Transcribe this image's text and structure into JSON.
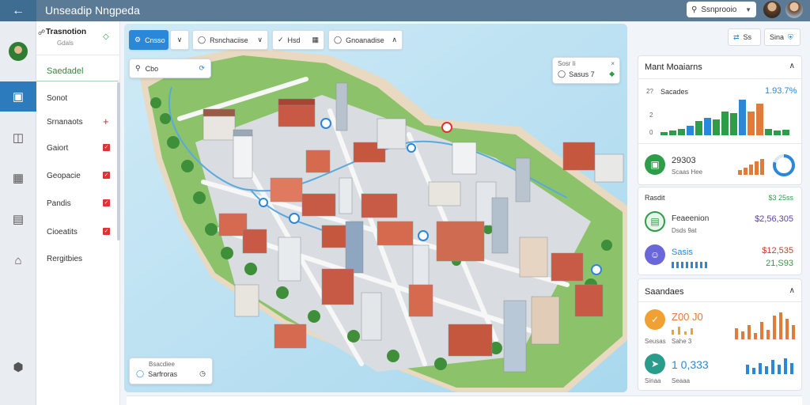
{
  "app": {
    "title": "Unseadip Nngpeda"
  },
  "topbar": {
    "search_label": "Ssnprooio"
  },
  "sidebar": {
    "header_title": "Trasnotion",
    "header_sub": "Gdals",
    "section": "Saedadel",
    "items": [
      {
        "label": "Sonot"
      },
      {
        "label": "Srnanaots"
      },
      {
        "label": "Gaiort"
      },
      {
        "label": "Geopacie"
      },
      {
        "label": "Pandis"
      },
      {
        "label": "Cioeatits"
      },
      {
        "label": "Rergitbies"
      }
    ]
  },
  "map": {
    "toolbar": [
      {
        "label": "Cnsso"
      },
      {
        "label": "Rsnchaciise"
      },
      {
        "label": "Hsd"
      },
      {
        "label": "Gnoanadise"
      }
    ],
    "search_chip": {
      "label": "Cbo"
    },
    "info_chip": {
      "title": "Sosr Ii",
      "label": "Sasus 7"
    },
    "legend_chip": {
      "title": "Bsacdiee",
      "label": "Sarfroras"
    }
  },
  "right_panel": {
    "top_buttons": [
      {
        "label": "Ss"
      },
      {
        "label": "Sina"
      }
    ],
    "panel1": {
      "title": "Mant Moaiarns",
      "metric_label": "Sacades",
      "axis_top": "2?",
      "axis_mid": "2",
      "axis_bottom": "0",
      "value": "1.93.7%",
      "bars": [
        {
          "h": 4,
          "c": "#2e9d4a"
        },
        {
          "h": 6,
          "c": "#2e9d4a"
        },
        {
          "h": 8,
          "c": "#2e9d4a"
        },
        {
          "h": 12,
          "c": "#2b88d8"
        },
        {
          "h": 18,
          "c": "#2e9d4a"
        },
        {
          "h": 22,
          "c": "#2b88d8"
        },
        {
          "h": 20,
          "c": "#2e9d4a"
        },
        {
          "h": 30,
          "c": "#2e9d4a"
        },
        {
          "h": 28,
          "c": "#2e9d4a"
        },
        {
          "h": 45,
          "c": "#2b88d8"
        },
        {
          "h": 30,
          "c": "#e07b39"
        },
        {
          "h": 40,
          "c": "#e07b39"
        },
        {
          "h": 8,
          "c": "#2e9d4a"
        },
        {
          "h": 6,
          "c": "#2e9d4a"
        },
        {
          "h": 7,
          "c": "#2e9d4a"
        }
      ],
      "stat_value": "29303",
      "stat_label": "Scaas Hee"
    },
    "panel2": {
      "title": "Rasdit",
      "title_value": "$3 25ss",
      "row1_title": "Feaeenion",
      "row1_sub": "Dsds 9at",
      "row1_value": "$2,56,305",
      "row2_title": "Sasis",
      "row2_value_top": "$12,535",
      "row2_value": "21,S93"
    },
    "panel3": {
      "title": "Saandaes",
      "row1_value": "Z00 J0",
      "row1_sub1": "Seusas",
      "row1_sub2": "Sahe 3",
      "row2_value": "1 0,333",
      "row2_sub1": "Sinaa",
      "row2_sub2": "Seaaa"
    }
  }
}
